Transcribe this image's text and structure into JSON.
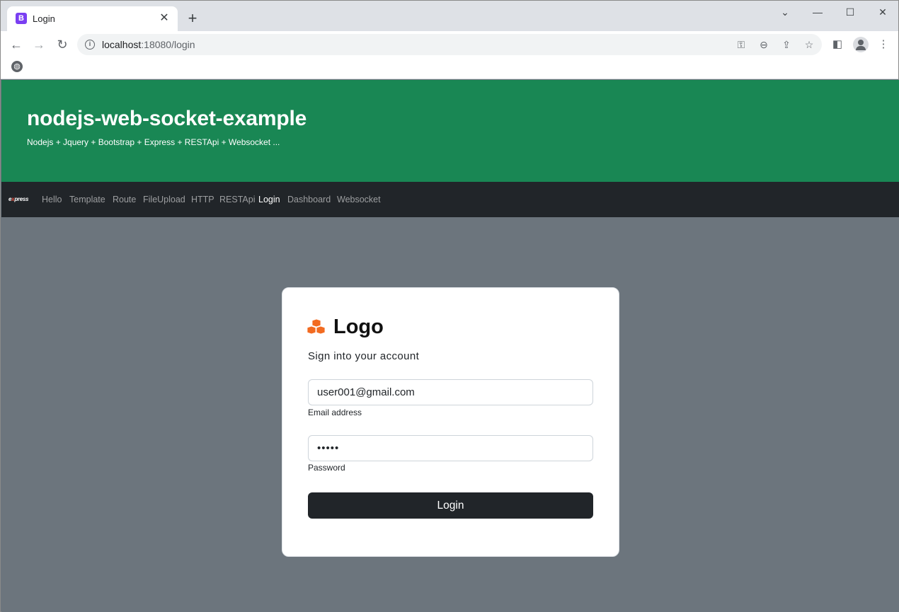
{
  "browser": {
    "tab_title": "Login",
    "tab_favicon_letter": "B",
    "url_host": "localhost",
    "url_rest": ":18080/login",
    "icons": {
      "close": "close-icon",
      "new_tab": "plus-icon",
      "minimize": "minimize-icon",
      "maximize": "maximize-icon",
      "window_close": "window-close-icon",
      "back": "back-arrow-icon",
      "forward": "forward-arrow-icon",
      "reload": "reload-icon",
      "info": "info-icon",
      "key": "key-icon",
      "zoom": "zoom-out-icon",
      "share": "share-icon",
      "star": "star-icon",
      "sidebar": "side-panel-icon",
      "profile": "profile-icon",
      "menu": "kebab-menu-icon",
      "globe": "globe-icon"
    }
  },
  "hero": {
    "title": "nodejs-web-socket-example",
    "subtitle": "Nodejs + Jquery + Bootstrap + Express + RESTApi + Websocket ..."
  },
  "navbar": {
    "brand_pre": "e",
    "brand_x": "x",
    "brand_post": "press",
    "links": [
      "Hello",
      "Template",
      "Route",
      "FileUpload",
      "HTTP",
      "RESTApi",
      "Login",
      "Dashboard",
      "Websocket"
    ],
    "active": "Login"
  },
  "login_form": {
    "logo_text": "Logo",
    "subtitle": "Sign into your account",
    "email_value": "user001@gmail.com",
    "email_label": "Email address",
    "password_value": "•••••",
    "password_label": "Password",
    "submit_label": "Login"
  },
  "colors": {
    "hero_bg": "#198754",
    "navbar_bg": "#212529",
    "page_bg": "#6c757d",
    "logo_accent": "#f26b21"
  }
}
